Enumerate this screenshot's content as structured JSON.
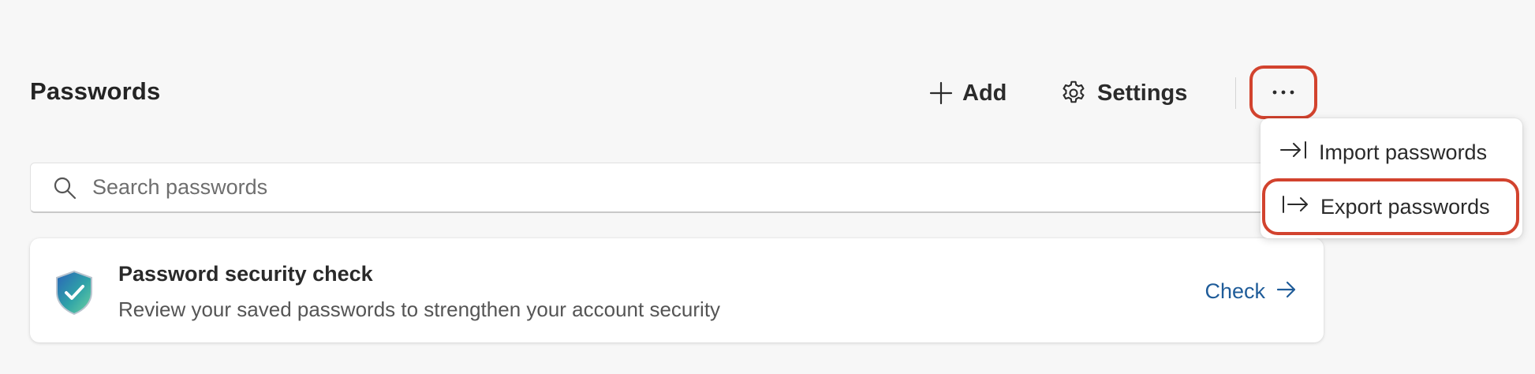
{
  "header": {
    "title": "Passwords",
    "add_label": "Add",
    "settings_label": "Settings",
    "more_label": "···"
  },
  "search": {
    "placeholder": "Search passwords",
    "value": ""
  },
  "security_card": {
    "title": "Password security check",
    "description": "Review your saved passwords to strengthen your account security",
    "action_label": "Check"
  },
  "more_menu": {
    "items": [
      {
        "label": "Import passwords",
        "icon": "import-icon"
      },
      {
        "label": "Export passwords",
        "icon": "export-icon"
      }
    ]
  },
  "colors": {
    "background": "#f7f7f7",
    "highlight": "#d2432e",
    "link": "#1f5c99"
  }
}
